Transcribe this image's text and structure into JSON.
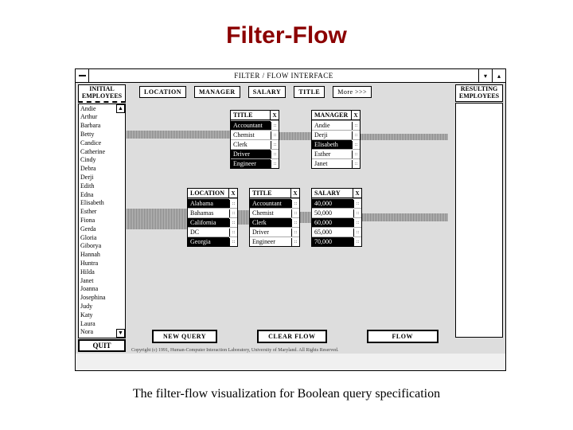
{
  "page": {
    "title": "Filter-Flow",
    "caption": "The filter-flow visualization for Boolean query specification"
  },
  "window": {
    "title": "FILTER / FLOW INTERFACE",
    "minimize": "▾",
    "maximize": "▴"
  },
  "initial": {
    "label_top": "INITIAL",
    "label_bot": "EMPLOYEES",
    "scroll_up": "▲",
    "scroll_down": "▼",
    "items": [
      "Andie",
      "Arthur",
      "Barbara",
      "Betty",
      "Candice",
      "Catherine",
      "Cindy",
      "Debra",
      "Derji",
      "Edith",
      "Edna",
      "Elisabeth",
      "Esther",
      "Fiona",
      "Gerda",
      "Gloria",
      "Giborya",
      "Hannah",
      "Huntra",
      "Hilda",
      "Janet",
      "Joanna",
      "Josephina",
      "Judy",
      "Katy",
      "Laura",
      "Nora"
    ]
  },
  "resulting": {
    "label_top": "RESULTING",
    "label_bot": "EMPLOYEES"
  },
  "attributes": {
    "location": "LOCATION",
    "manager": "MANAGER",
    "salary": "SALARY",
    "title": "TITLE",
    "more": "More >>>"
  },
  "filter_title1": {
    "head": "TITLE",
    "close": "X",
    "items": [
      {
        "v": "Accountant",
        "sel": true
      },
      {
        "v": "Chemist",
        "sel": false
      },
      {
        "v": "Clerk",
        "sel": false
      },
      {
        "v": "Driver",
        "sel": true
      },
      {
        "v": "Engineer",
        "sel": true
      }
    ]
  },
  "filter_manager": {
    "head": "MANAGER",
    "close": "X",
    "items": [
      {
        "v": "Andie",
        "sel": false
      },
      {
        "v": "Derji",
        "sel": false
      },
      {
        "v": "Elisabeth",
        "sel": true
      },
      {
        "v": "Esther",
        "sel": false
      },
      {
        "v": "Janet",
        "sel": false
      }
    ]
  },
  "filter_location": {
    "head": "LOCATION",
    "close": "X",
    "items": [
      {
        "v": "Alabama",
        "sel": true
      },
      {
        "v": "Bahamas",
        "sel": false
      },
      {
        "v": "California",
        "sel": true
      },
      {
        "v": "DC",
        "sel": false
      },
      {
        "v": "Georgia",
        "sel": true
      }
    ]
  },
  "filter_title2": {
    "head": "TITLE",
    "close": "X",
    "items": [
      {
        "v": "Accountant",
        "sel": true
      },
      {
        "v": "Chemist",
        "sel": false
      },
      {
        "v": "Clerk",
        "sel": true
      },
      {
        "v": "Driver",
        "sel": false
      },
      {
        "v": "Engineer",
        "sel": false
      }
    ]
  },
  "filter_salary": {
    "head": "SALARY",
    "close": "X",
    "items": [
      {
        "v": "40,000",
        "sel": true
      },
      {
        "v": "50,000",
        "sel": false
      },
      {
        "v": "60,000",
        "sel": true
      },
      {
        "v": "65,000",
        "sel": false
      },
      {
        "v": "70,000",
        "sel": true
      }
    ]
  },
  "buttons": {
    "quit": "QUIT",
    "new_query": "NEW QUERY",
    "clear_flow": "CLEAR FLOW",
    "flow": "FLOW"
  },
  "copyright": "Copyright (c) 1991, Human-Computer Interaction Laboratory, University of Maryland. All Rights Reserved."
}
